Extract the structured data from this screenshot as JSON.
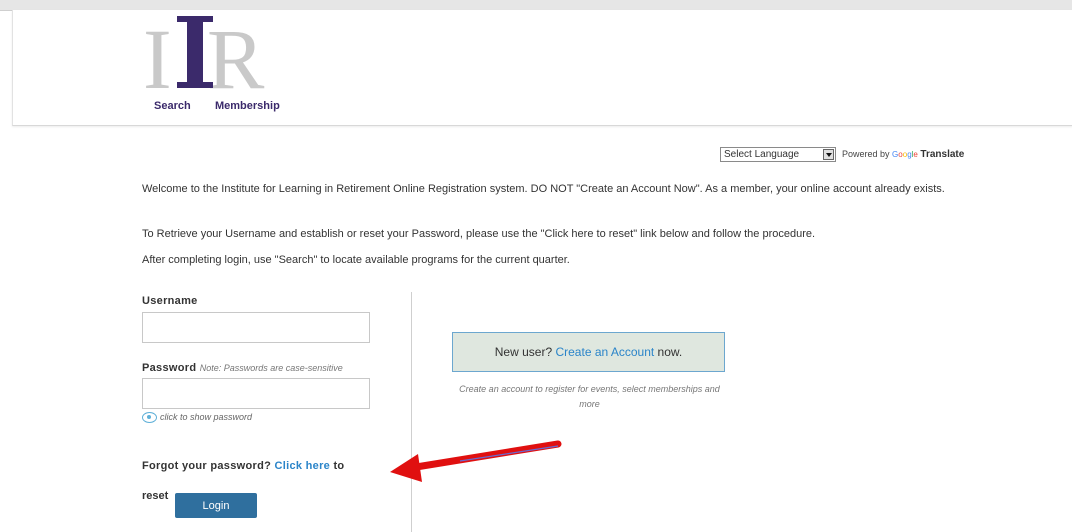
{
  "header": {
    "logo": {
      "text": "ILR",
      "colors": {
        "outer": "#c9c9c9",
        "inner": "#3b2a6b"
      }
    },
    "nav": {
      "search": "Search",
      "membership": "Membership"
    }
  },
  "translate": {
    "select_label": "Select Language",
    "powered_by": "Powered by",
    "google": "Google",
    "translate": "Translate"
  },
  "content": {
    "welcome": "Welcome to the Institute for Learning in Retirement Online Registration system. DO NOT \"Create an Account Now\". As a member, your online account already exists.",
    "retrieve": "To Retrieve your Username and establish or reset your Password, please use the \"Click here to reset\" link below and follow the procedure.",
    "after_login": "After completing login, use \"Search\" to locate available programs for the current quarter."
  },
  "login": {
    "username_label": "Username",
    "username_value": "",
    "password_label": "Password",
    "password_note": "Note: Passwords are case-sensitive",
    "password_value": "",
    "show_password": "click to show password",
    "forgot_prefix": "Forgot your password?",
    "forgot_link": "Click here",
    "forgot_suffix": "to",
    "reset_word": "reset",
    "login_button": "Login"
  },
  "newuser": {
    "prefix": "New user?",
    "link": "Create an Account",
    "suffix": "now.",
    "description": "Create an account to register for events, select memberships and more"
  },
  "colors": {
    "accent": "#2a84c9",
    "login_button": "#2f6f9e",
    "annotation_arrow": "#e01010"
  }
}
